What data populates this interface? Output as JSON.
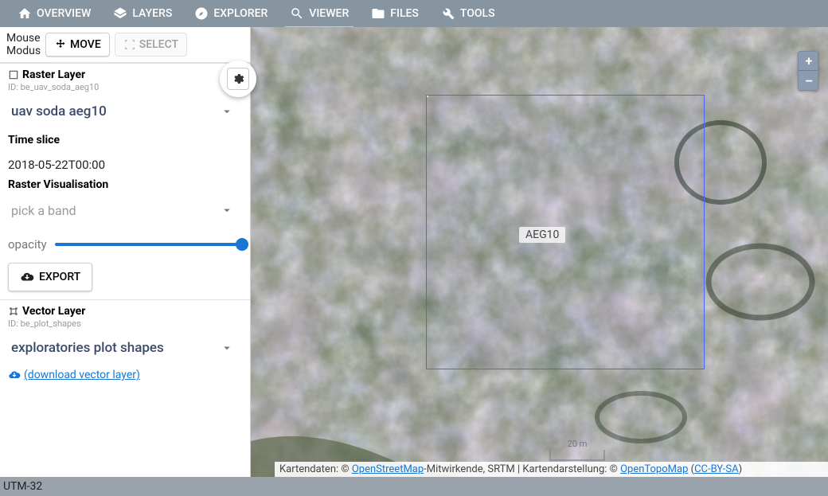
{
  "nav": {
    "items": [
      {
        "label": "OVERVIEW",
        "icon": "home"
      },
      {
        "label": "LAYERS",
        "icon": "layers"
      },
      {
        "label": "EXPLORER",
        "icon": "compass"
      },
      {
        "label": "VIEWER",
        "icon": "search",
        "active": true
      },
      {
        "label": "FILES",
        "icon": "folder"
      },
      {
        "label": "TOOLS",
        "icon": "wrench"
      }
    ]
  },
  "sidebar": {
    "mouse_modus": {
      "label_line1": "Mouse",
      "label_line2": "Modus",
      "move_label": "MOVE",
      "select_label": "SELECT"
    },
    "raster": {
      "heading": "Raster Layer",
      "id_prefix": "ID: ",
      "id": "be_uav_soda_aeg10",
      "dropdown_value": "uav soda aeg10",
      "time_slice_label": "Time slice",
      "time_slice_value": "2018-05-22T00:00",
      "visualisation_label": "Raster Visualisation",
      "band_placeholder": "pick a band",
      "opacity_label": "opacity",
      "opacity_value": 100,
      "export_label": "EXPORT"
    },
    "vector": {
      "heading": "Vector Layer",
      "id_prefix": "ID: ",
      "id": "be_plot_shapes",
      "dropdown_value": "exploratories plot shapes",
      "download_label": "(download vector layer)"
    }
  },
  "map": {
    "plot_label": "AEG10",
    "zoom_in": "+",
    "zoom_out": "–",
    "scale_label": "20 m",
    "attribution": {
      "prefix": "Kartendaten: © ",
      "osm": "OpenStreetMap",
      "mid1": "-Mitwirkende, SRTM | Kartendarstellung: © ",
      "otm": "OpenTopoMap",
      "open_paren": " (",
      "license": "CC-BY-SA",
      "close_paren": ")"
    }
  },
  "status": {
    "crs": "UTM-32"
  }
}
